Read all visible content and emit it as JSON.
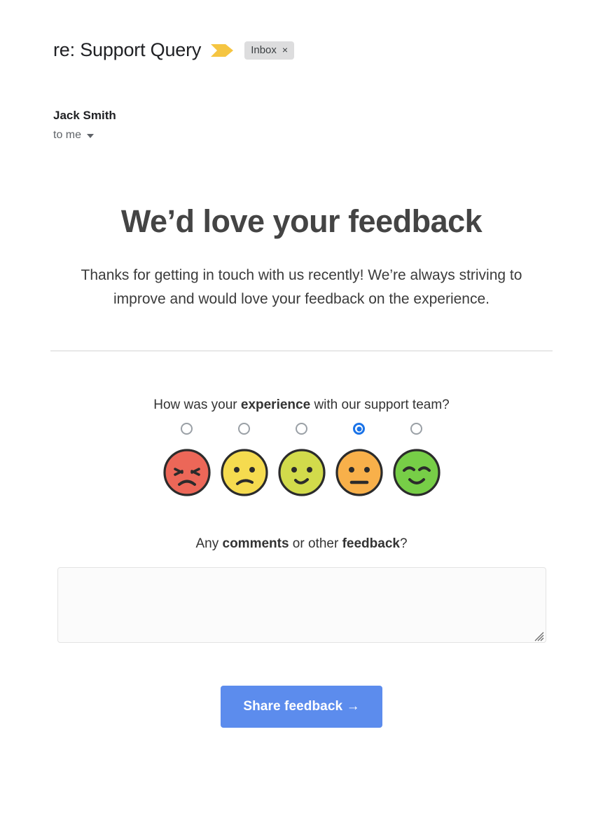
{
  "mail": {
    "subject": "re: Support Query",
    "flag_icon": "yellow-flag-icon",
    "label": "Inbox",
    "label_close_icon": "×",
    "sender": "Jack Smith",
    "recipient": "to me",
    "recipient_caret_icon": "chevron-down-icon"
  },
  "content": {
    "headline": "We’d love your feedback",
    "intro": "Thanks for getting in touch with us recently! We’re always striving to improve and would love your feedback on the experience."
  },
  "rating": {
    "question_prefix": "How was your ",
    "question_bold": "experience",
    "question_suffix": " with our support team?",
    "selected_index": 3,
    "options": [
      {
        "name": "angry-face-icon",
        "color": "#EC6758",
        "mouth": "frown",
        "eyes": "angry"
      },
      {
        "name": "sad-face-icon",
        "color": "#F5DB4F",
        "mouth": "slight-frown",
        "eyes": "dots"
      },
      {
        "name": "neutral-face-icon",
        "color": "#D2DB4B",
        "mouth": "slight-smile",
        "eyes": "dots"
      },
      {
        "name": "flat-face-icon",
        "color": "#F8B04A",
        "mouth": "flat",
        "eyes": "dots"
      },
      {
        "name": "happy-face-icon",
        "color": "#77CE47",
        "mouth": "smile",
        "eyes": "arcs"
      }
    ]
  },
  "comments": {
    "label_prefix": "Any ",
    "label_bold_1": "comments",
    "label_middle": " or other ",
    "label_bold_2": "feedback",
    "label_suffix": "?",
    "value": "",
    "placeholder": ""
  },
  "submit": {
    "label": "Share feedback →",
    "color": "#5c8ced"
  }
}
